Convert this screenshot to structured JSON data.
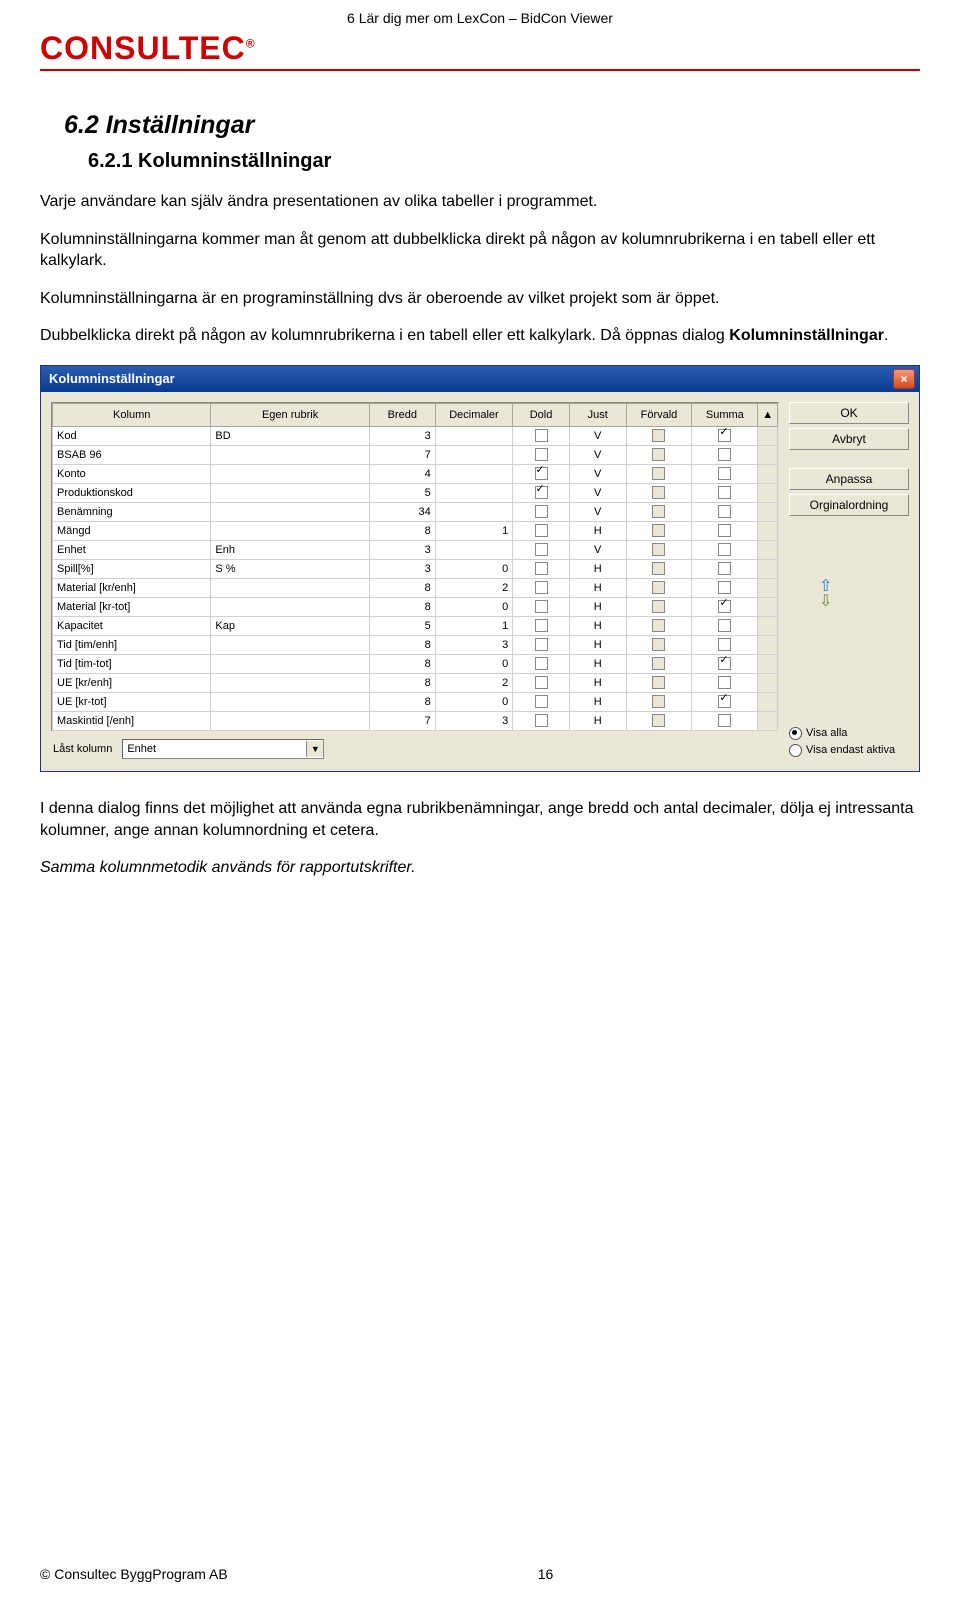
{
  "header": {
    "chapter": "6 Lär dig mer om LexCon – BidCon Viewer",
    "logo_text": "CONSULTEC",
    "logo_registered": "®"
  },
  "section": {
    "h2": "6.2 Inställningar",
    "h3": "6.2.1 Kolumninställningar",
    "para1": "Varje användare kan själv ändra presentationen av olika tabeller i programmet.",
    "para2": "Kolumninställningarna kommer man åt genom att dubbelklicka direkt på någon av kolumnrubrikerna i en tabell eller ett kalkylark.",
    "para3": "Kolumninställningarna är en programinställning dvs är oberoende av vilket projekt som är öppet.",
    "para4a": "Dubbelklicka direkt på någon av kolumnrubrikerna i en tabell eller ett kalkylark. Då öppnas dialog ",
    "para4b_bold": "Kolumninställningar",
    "para4c": ".",
    "para5": "I denna dialog finns det möjlighet att använda egna rubrikbenämningar, ange bredd och antal decimaler, dölja ej intressanta kolumner, ange annan kolumnordning et cetera.",
    "para6_italic": "Samma kolumnmetodik används för rapportutskrifter."
  },
  "dialog": {
    "title": "Kolumninställningar",
    "close_glyph": "×",
    "headers": [
      "Kolumn",
      "Egen rubrik",
      "Bredd",
      "Decimaler",
      "Dold",
      "Just",
      "Förvald",
      "Summa",
      "▲"
    ],
    "rows": [
      {
        "k": "Kod",
        "e": "BD",
        "b": "3",
        "d": "",
        "dold": false,
        "just": "V",
        "forv": "gray",
        "sum": true
      },
      {
        "k": "BSAB 96",
        "e": "",
        "b": "7",
        "d": "",
        "dold": false,
        "just": "V",
        "forv": "gray",
        "sum": false
      },
      {
        "k": "Konto",
        "e": "",
        "b": "4",
        "d": "",
        "dold": true,
        "just": "V",
        "forv": "gray",
        "sum": false
      },
      {
        "k": "Produktionskod",
        "e": "",
        "b": "5",
        "d": "",
        "dold": true,
        "just": "V",
        "forv": "gray",
        "sum": false
      },
      {
        "k": "Benämning",
        "e": "",
        "b": "34",
        "d": "",
        "dold": false,
        "just": "V",
        "forv": "gray",
        "sum": false
      },
      {
        "k": "Mängd",
        "e": "",
        "b": "8",
        "d": "1",
        "dold": false,
        "just": "H",
        "forv": "gray",
        "sum": false
      },
      {
        "k": "Enhet",
        "e": "Enh",
        "b": "3",
        "d": "",
        "dold": false,
        "just": "V",
        "forv": "gray",
        "sum": false
      },
      {
        "k": "Spill[%]",
        "e": "S %",
        "b": "3",
        "d": "0",
        "dold": false,
        "just": "H",
        "forv": "gray",
        "sum": false
      },
      {
        "k": "Material [kr/enh]",
        "e": "",
        "b": "8",
        "d": "2",
        "dold": false,
        "just": "H",
        "forv": "gray",
        "sum": false
      },
      {
        "k": "Material [kr-tot]",
        "e": "",
        "b": "8",
        "d": "0",
        "dold": false,
        "just": "H",
        "forv": "gray",
        "sum": true
      },
      {
        "k": "Kapacitet",
        "e": "Kap",
        "b": "5",
        "d": "1",
        "dold": false,
        "just": "H",
        "forv": "gray",
        "sum": false
      },
      {
        "k": "Tid [tim/enh]",
        "e": "",
        "b": "8",
        "d": "3",
        "dold": false,
        "just": "H",
        "forv": "gray",
        "sum": false
      },
      {
        "k": "Tid [tim-tot]",
        "e": "",
        "b": "8",
        "d": "0",
        "dold": false,
        "just": "H",
        "forv": "gray",
        "sum": true
      },
      {
        "k": "UE [kr/enh]",
        "e": "",
        "b": "8",
        "d": "2",
        "dold": false,
        "just": "H",
        "forv": "gray",
        "sum": false
      },
      {
        "k": "UE [kr-tot]",
        "e": "",
        "b": "8",
        "d": "0",
        "dold": false,
        "just": "H",
        "forv": "gray",
        "sum": true
      },
      {
        "k": "Maskintid [/enh]",
        "e": "",
        "b": "7",
        "d": "3",
        "dold": false,
        "just": "H",
        "forv": "gray",
        "sum": false
      }
    ],
    "buttons": {
      "ok": "OK",
      "avbryt": "Avbryt",
      "anpassa": "Anpassa",
      "orginal": "Orginalordning"
    },
    "radios": {
      "visa_alla": "Visa alla",
      "visa_endast": "Visa endast aktiva",
      "selected": "visa_alla"
    },
    "arrows": {
      "up": "⇧",
      "down": "⇩"
    },
    "locked_label": "Låst kolumn",
    "locked_value": "Enhet",
    "combo_chevron": "▼"
  },
  "footer": {
    "copyright": "© Consultec ByggProgram AB",
    "page_no": "16"
  }
}
